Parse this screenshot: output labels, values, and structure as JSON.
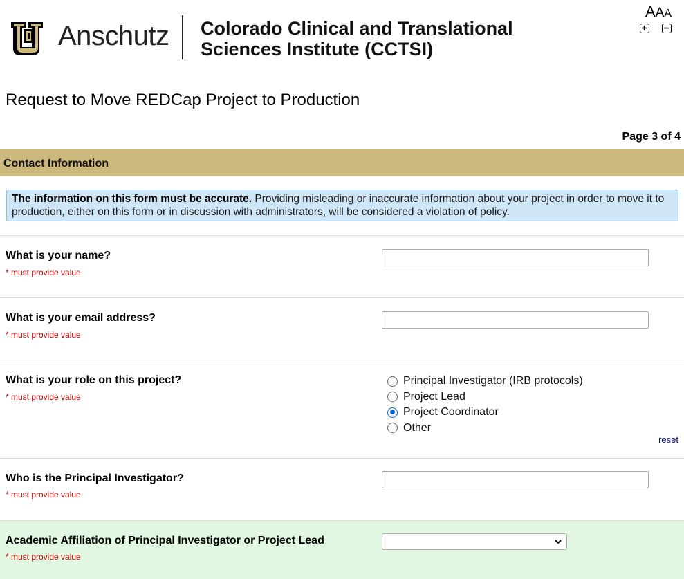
{
  "header": {
    "logo_word": "Anschutz",
    "institution_line1": "Colorado Clinical and Translational",
    "institution_line2": "Sciences Institute (CCTSI)",
    "font_size_letters": [
      "A",
      "A",
      "A"
    ],
    "zoom_in_icon": "plus-square-icon",
    "zoom_out_icon": "minus-square-icon"
  },
  "page": {
    "title": "Request to Move REDCap Project to Production",
    "indicator": "Page 3 of 4"
  },
  "section": {
    "title": "Contact Information"
  },
  "notice": {
    "bold": "The information on this form must be accurate.",
    "text": " Providing misleading or inaccurate information about your project in order to move it to production, either on this form or in discussion with administrators, will be considered a violation of policy."
  },
  "required_text": "* must provide value",
  "questions": {
    "name": {
      "label": "What is your name?",
      "value": ""
    },
    "email": {
      "label": "What is your email address?",
      "value": ""
    },
    "role": {
      "label": "What is your role on this project?",
      "options": [
        "Principal Investigator (IRB protocols)",
        "Project Lead",
        "Project Coordinator",
        "Other"
      ],
      "selected": "Project Coordinator",
      "reset_label": "reset"
    },
    "pi": {
      "label": "Who is the Principal Investigator?",
      "value": ""
    },
    "affiliation": {
      "label": "Academic Affiliation of Principal Investigator or Project Lead",
      "selected": ""
    }
  },
  "colors": {
    "section_header_bg": "#cdb97d",
    "notice_bg": "#cfe6f7",
    "required_text": "#c00000",
    "highlight_row_bg": "#e2f7e2",
    "radio_checked": "#0a66d6",
    "logo_gold": "#cfb87c"
  }
}
